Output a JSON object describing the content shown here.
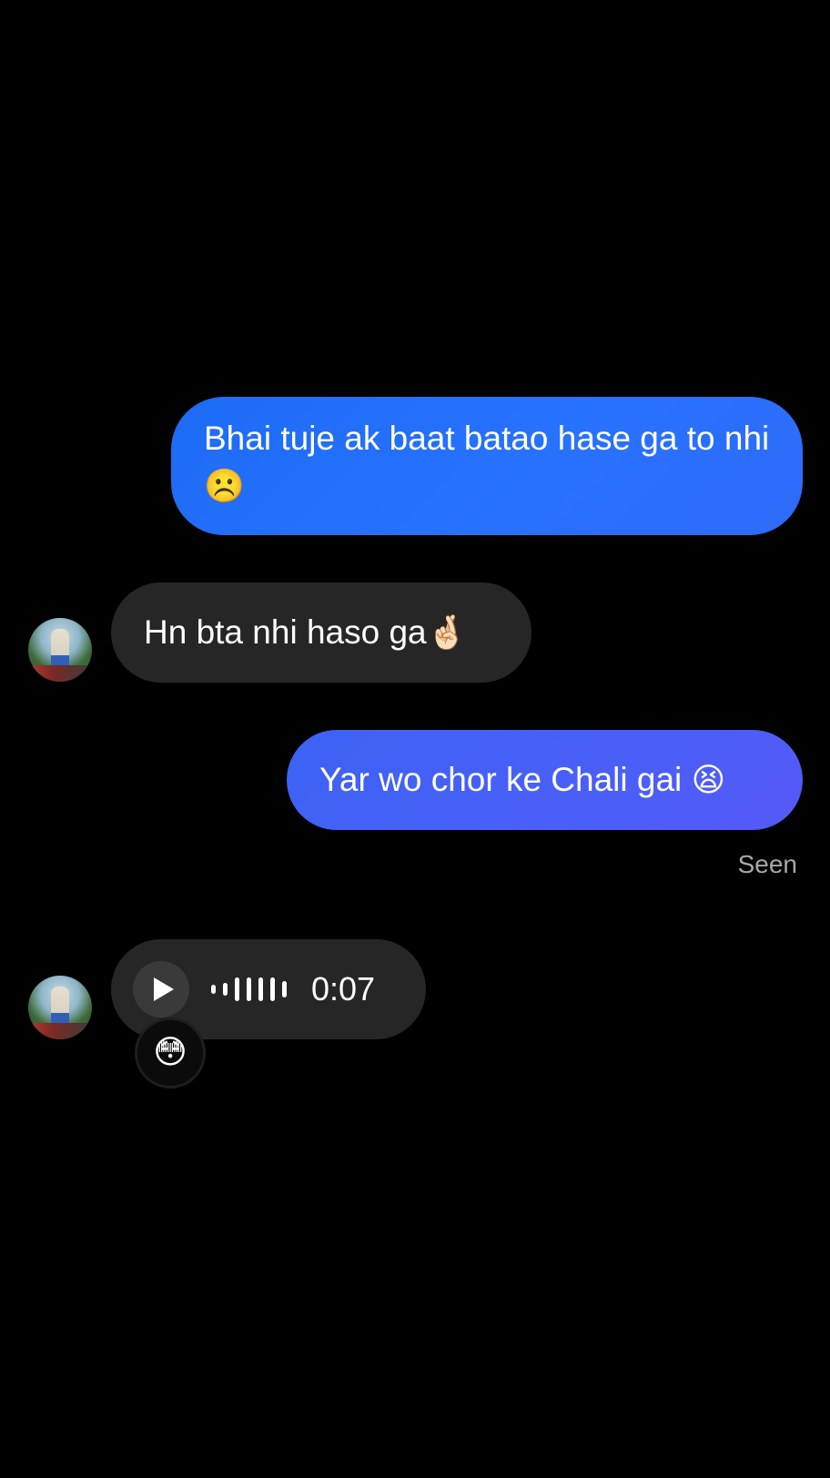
{
  "colors": {
    "background": "#000000",
    "outgoing_bubble_start": "#1d6cf4",
    "outgoing_bubble_end": "#5559f7",
    "incoming_bubble": "#262626",
    "seen_text": "#a8a8a8"
  },
  "messages": [
    {
      "direction": "outgoing",
      "text": "Bhai tuje ak baat batao hase ga to nhi",
      "emoji": "☹️"
    },
    {
      "direction": "incoming",
      "text": "Hn bta nhi haso ga",
      "emoji": "🤞🏻",
      "avatar_icon": "profile-photo-icon"
    },
    {
      "direction": "outgoing",
      "text": "Yar wo chor ke Chali gai",
      "emoji": "😫"
    }
  ],
  "status": {
    "seen_label": "Seen"
  },
  "voice_message": {
    "direction": "incoming",
    "play_icon": "play-icon",
    "duration": "0:07",
    "reaction_emoji": "😳",
    "avatar_icon": "profile-photo-icon"
  }
}
